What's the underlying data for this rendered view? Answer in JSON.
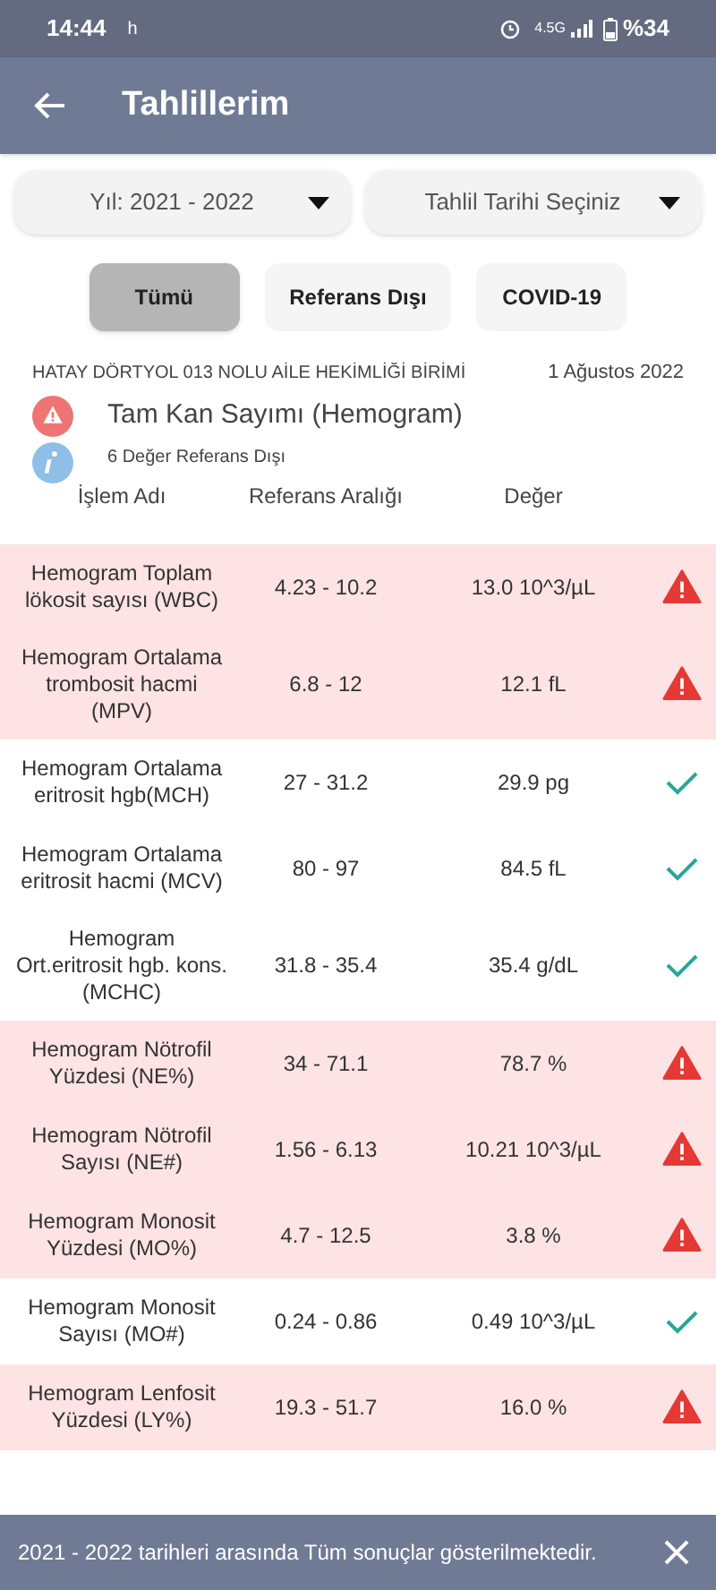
{
  "status_bar": {
    "time": "14:44",
    "notification": "h",
    "network": "4.5G",
    "battery": "%34"
  },
  "app_bar": {
    "title": "Tahlillerim"
  },
  "filters": [
    {
      "label": "Yıl: 2021 - 2022"
    },
    {
      "label": "Tahlil Tarihi Seçiniz"
    }
  ],
  "tabs": [
    {
      "label": "Tümü",
      "selected": true
    },
    {
      "label": "Referans Dışı",
      "selected": false
    },
    {
      "label": "COVID-19",
      "selected": false
    }
  ],
  "report": {
    "institution": "HATAY DÖRTYOL 013 NOLU AİLE HEKİMLİĞİ BİRİMİ",
    "date": "1 Ağustos 2022",
    "test_name": "Tam Kan Sayımı (Hemogram)",
    "summary": "6 Değer Referans Dışı"
  },
  "table": {
    "columns": [
      "İşlem Adı",
      "Referans Aralığı",
      "Değer"
    ],
    "rows": [
      {
        "name": "Hemogram Toplam lökosit sayısı (WBC)",
        "range": "4.23 - 10.2",
        "value": "13.0 10^3/µL",
        "out_of_range": true
      },
      {
        "name": "Hemogram Ortalama trombosit hacmi (MPV)",
        "range": "6.8 - 12",
        "value": "12.1 fL",
        "out_of_range": true
      },
      {
        "name": "Hemogram Ortalama eritrosit hgb(MCH)",
        "range": "27 - 31.2",
        "value": "29.9 pg",
        "out_of_range": false
      },
      {
        "name": "Hemogram Ortalama eritrosit hacmi (MCV)",
        "range": "80 - 97",
        "value": "84.5 fL",
        "out_of_range": false
      },
      {
        "name": "Hemogram Ort.eritrosit hgb. kons.(MCHC)",
        "range": "31.8 - 35.4",
        "value": "35.4 g/dL",
        "out_of_range": false
      },
      {
        "name": "Hemogram Nötrofil Yüzdesi (NE%)",
        "range": "34 - 71.1",
        "value": "78.7 %",
        "out_of_range": true
      },
      {
        "name": "Hemogram Nötrofil Sayısı (NE#)",
        "range": "1.56 - 6.13",
        "value": "10.21 10^3/µL",
        "out_of_range": true
      },
      {
        "name": "Hemogram Monosit Yüzdesi (MO%)",
        "range": "4.7 - 12.5",
        "value": "3.8 %",
        "out_of_range": true
      },
      {
        "name": "Hemogram Monosit Sayısı (MO#)",
        "range": "0.24 - 0.86",
        "value": "0.49 10^3/µL",
        "out_of_range": false
      },
      {
        "name": "Hemogram Lenfosit Yüzdesi (LY%)",
        "range": "19.3 - 51.7",
        "value": "16.0 %",
        "out_of_range": true
      }
    ]
  },
  "snackbar": {
    "message": "2021 - 2022 tarihleri arasında Tüm sonuçlar gösterilmektedir."
  }
}
